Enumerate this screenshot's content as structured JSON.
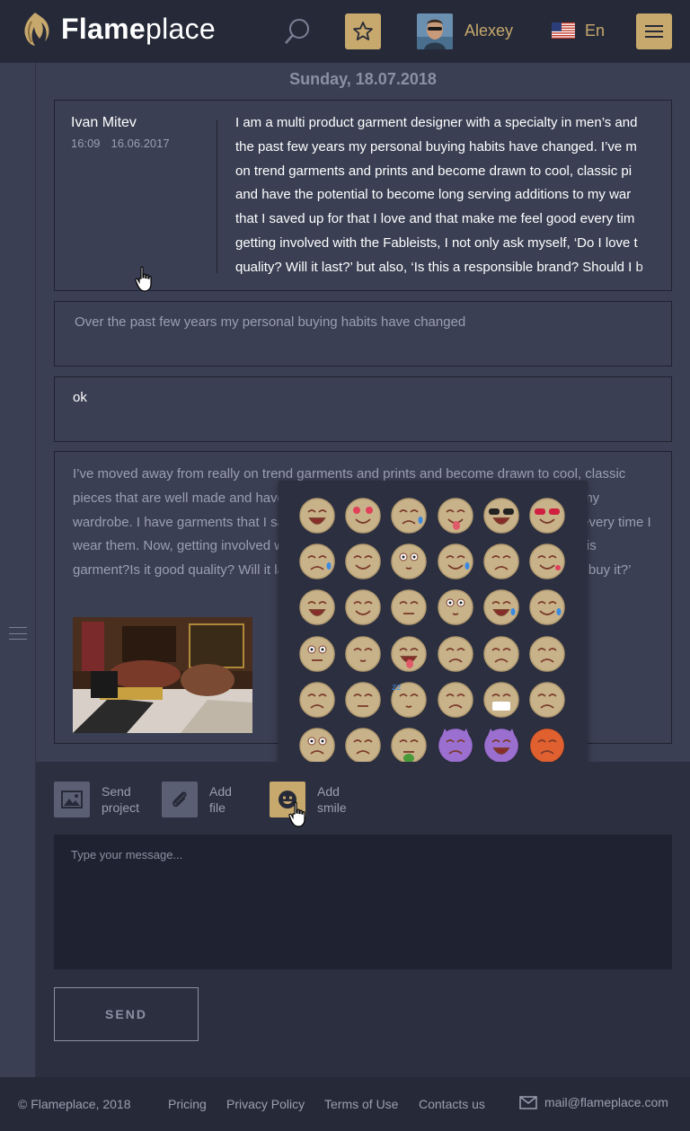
{
  "header": {
    "logo_bold": "Flame",
    "logo_light": "place",
    "user_name": "Alexey",
    "language": "En"
  },
  "date": "Sunday, 18.07.2018",
  "messages": [
    {
      "author": "Ivan Mitev",
      "time": "16:09",
      "date": "16.06.2017",
      "lines": [
        "I am a multi product garment designer with a specialty in men’s and",
        "the past few years my personal buying habits have changed. I’ve m",
        "on trend garments and prints and become drawn to cool, classic pi",
        "and have the potential to become long serving additions to my war",
        "that I saved up for that I love and that make me feel good every tim",
        "getting involved with the Fableists, I not only ask myself, ‘Do I love t",
        "quality? Will it last?’ but also, ‘Is this a responsible brand? Should I b"
      ]
    },
    {
      "text": "Over the past few years my personal buying habits have changed"
    },
    {
      "text": "ok"
    },
    {
      "text": "I’ve moved away from really on trend garments and prints and become drawn to cool, classic pieces that are well made and have the potential to become long serving additions to my wardrobe. I have garments that I saved up for that I love and that make me feel good every time I wear them. Now, getting involved with the Fableists, I not only ask myself, ‘Do I love this garment?Is it good quality? Will it last?’ but also, ‘Is this a responsible brand? Should I buy it?’"
    }
  ],
  "emoji_picker": {
    "emojis": [
      "grinning-face",
      "heart-eyes",
      "sad-sweat",
      "winking-tongue",
      "cool-sunglasses",
      "heart-sunglasses",
      "crying-face",
      "winking-grin",
      "surprised",
      "tears-of-joy",
      "unamused",
      "kissing-heart",
      "relieved",
      "smiling-eyes",
      "grimacing",
      "flushed",
      "grinning-sweat-drops",
      "sweat-smile",
      "neutral-wide-eyes",
      "dizzy-face",
      "squinting-tongue",
      "frowning",
      "confounded",
      "pensive",
      "disappointed",
      "straight-face",
      "sleeping",
      "persevering",
      "medical-mask",
      "worried",
      "sad-wide",
      "anguished",
      "nauseated",
      "imp",
      "smiling-devil",
      "angry-red"
    ]
  },
  "composer": {
    "send_project_label": "Send\nproject",
    "add_file_label": "Add\nfile",
    "add_smile_label": "Add\nsmile",
    "placeholder": "Type your message...",
    "send_label": "SEND"
  },
  "footer": {
    "copyright": "© Flameplace, 2018",
    "links": [
      "Pricing",
      "Privacy Policy",
      "Terms of Use",
      "Contacts us"
    ],
    "email": "mail@flameplace.com"
  },
  "colors": {
    "accent": "#c7a86d",
    "background": "#3a3f53",
    "header": "#262a38",
    "panel": "#2b2f3f"
  }
}
